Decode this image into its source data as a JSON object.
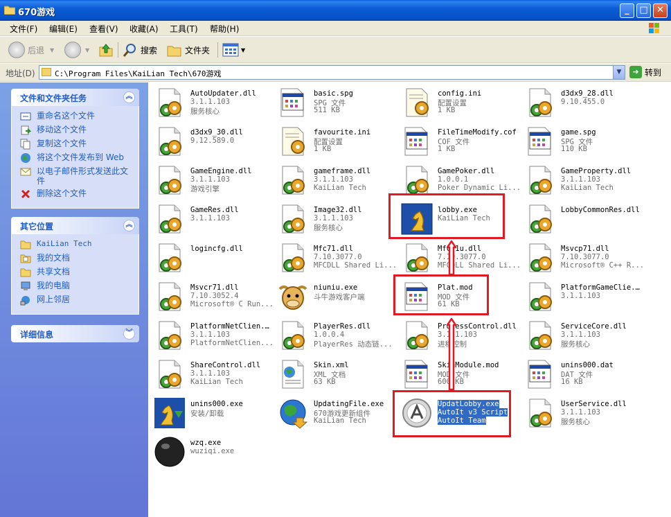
{
  "window": {
    "title": "670游戏"
  },
  "menu": [
    {
      "label": "文件(F)"
    },
    {
      "label": "编辑(E)"
    },
    {
      "label": "查看(V)"
    },
    {
      "label": "收藏(A)"
    },
    {
      "label": "工具(T)"
    },
    {
      "label": "帮助(H)"
    }
  ],
  "toolbar": {
    "back": "后退",
    "search": "搜索",
    "folders": "文件夹"
  },
  "address": {
    "label": "地址(D)",
    "path": "C:\\Program Files\\KaiLian Tech\\670游戏",
    "go": "转到"
  },
  "panels": {
    "tasks": {
      "title": "文件和文件夹任务",
      "items": [
        "重命名这个文件",
        "移动这个文件",
        "复制这个文件",
        "将这个文件发布到 Web",
        "以电子邮件形式发送此文件",
        "删除这个文件"
      ]
    },
    "places": {
      "title": "其它位置",
      "items": [
        "KaiLian Tech",
        "我的文档",
        "共享文档",
        "我的电脑",
        "网上邻居"
      ]
    },
    "details": {
      "title": "详细信息"
    }
  },
  "files": [
    {
      "name": "AutoUpdater.dll",
      "l1": "3.1.1.103",
      "l2": "服务核心",
      "icon": "dll-icon"
    },
    {
      "name": "basic.spg",
      "l1": "SPG 文件",
      "l2": "511 KB",
      "icon": "spg-icon"
    },
    {
      "name": "config.ini",
      "l1": "配置设置",
      "l2": "1 KB",
      "icon": "ini-icon"
    },
    {
      "name": "d3dx9_28.dll",
      "l1": "9.10.455.0",
      "l2": "",
      "icon": "dll-icon"
    },
    {
      "name": "d3dx9_30.dll",
      "l1": "9.12.589.0",
      "l2": "",
      "icon": "dll-icon"
    },
    {
      "name": "favourite.ini",
      "l1": "配置设置",
      "l2": "1 KB",
      "icon": "ini-icon"
    },
    {
      "name": "FileTimeModify.cof",
      "l1": "COF 文件",
      "l2": "1 KB",
      "icon": "generic-file-icon"
    },
    {
      "name": "game.spg",
      "l1": "SPG 文件",
      "l2": "110 KB",
      "icon": "spg-icon"
    },
    {
      "name": "GameEngine.dll",
      "l1": "3.1.1.103",
      "l2": "游戏引擎",
      "icon": "dll-icon"
    },
    {
      "name": "gameframe.dll",
      "l1": "3.1.1.103",
      "l2": "KaiLian Tech",
      "icon": "dll-icon"
    },
    {
      "name": "GamePoker.dll",
      "l1": "1.0.0.1",
      "l2": "Poker Dynamic Li...",
      "icon": "dll-icon"
    },
    {
      "name": "GameProperty.dll",
      "l1": "3.1.1.103",
      "l2": "KaiLian Tech",
      "icon": "dll-icon"
    },
    {
      "name": "GameRes.dll",
      "l1": "3.1.1.103",
      "l2": "",
      "icon": "dll-icon"
    },
    {
      "name": "Image32.dll",
      "l1": "3.1.1.103",
      "l2": "服务核心",
      "icon": "dll-icon"
    },
    {
      "name": "lobby.exe",
      "l1": "KaiLian Tech",
      "l2": "",
      "icon": "chess-knight-icon"
    },
    {
      "name": "LobbyCommonRes.dll",
      "l1": "",
      "l2": "",
      "icon": "dll-icon"
    },
    {
      "name": "logincfg.dll",
      "l1": "",
      "l2": "",
      "icon": "dll-icon"
    },
    {
      "name": "Mfc71.dll",
      "l1": "7.10.3077.0",
      "l2": "MFCDLL Shared Li...",
      "icon": "dll-icon"
    },
    {
      "name": "Mfc71u.dll",
      "l1": "7.10.3077.0",
      "l2": "MFCDLL Shared Li...",
      "icon": "dll-icon"
    },
    {
      "name": "Msvcp71.dll",
      "l1": "7.10.3077.0",
      "l2": "Microsoft® C++ R...",
      "icon": "dll-icon"
    },
    {
      "name": "Msvcr71.dll",
      "l1": "7.10.3052.4",
      "l2": "Microsoft® C Run...",
      "icon": "dll-icon"
    },
    {
      "name": "niuniu.exe",
      "l1": "斗牛游戏客户端",
      "l2": "",
      "icon": "bull-icon"
    },
    {
      "name": "Plat.mod",
      "l1": "MOD 文件",
      "l2": "61 KB",
      "icon": "generic-file-icon"
    },
    {
      "name": "PlatformGameClie...",
      "l1": "3.1.1.103",
      "l2": "",
      "icon": "dll-icon"
    },
    {
      "name": "PlatformNetClien...",
      "l1": "3.1.1.103",
      "l2": "PlatformNetClien...",
      "icon": "dll-icon"
    },
    {
      "name": "PlayerRes.dll",
      "l1": "1.0.0.4",
      "l2": "PlayerRes 动态链...",
      "icon": "dll-icon"
    },
    {
      "name": "ProcessControl.dll",
      "l1": "3.1.1.103",
      "l2": "进程控制",
      "icon": "dll-icon"
    },
    {
      "name": "ServiceCore.dll",
      "l1": "3.1.1.103",
      "l2": "服务核心",
      "icon": "dll-icon"
    },
    {
      "name": "ShareControl.dll",
      "l1": "3.1.1.103",
      "l2": "KaiLian Tech",
      "icon": "dll-icon"
    },
    {
      "name": "Skin.xml",
      "l1": "XML 文档",
      "l2": "63 KB",
      "icon": "xml-icon"
    },
    {
      "name": "SkinModule.mod",
      "l1": "MOD 文件",
      "l2": "600 KB",
      "icon": "mod-icon"
    },
    {
      "name": "unins000.dat",
      "l1": "DAT 文件",
      "l2": "16 KB",
      "icon": "dat-icon"
    },
    {
      "name": "unins000.exe",
      "l1": "安装/卸载",
      "l2": "",
      "icon": "installer-icon"
    },
    {
      "name": "UpdatingFile.exe",
      "l1": "670游戏更新组件",
      "l2": "KaiLian Tech",
      "icon": "globe-update-icon"
    },
    {
      "name": "UpdatLobby.exe",
      "l1": "AutoIt v3 Script",
      "l2": "AutoIt Team",
      "icon": "autoit-icon",
      "selected": true
    },
    {
      "name": "UserService.dll",
      "l1": "3.1.1.103",
      "l2": "服务核心",
      "icon": "dll-icon"
    },
    {
      "name": "wzq.exe",
      "l1": "wuziqi.exe",
      "l2": "",
      "icon": "go-stone-icon"
    }
  ],
  "colors": {
    "highlight": "#e01a22",
    "selection": "#316ac5",
    "link": "#215dc6"
  }
}
